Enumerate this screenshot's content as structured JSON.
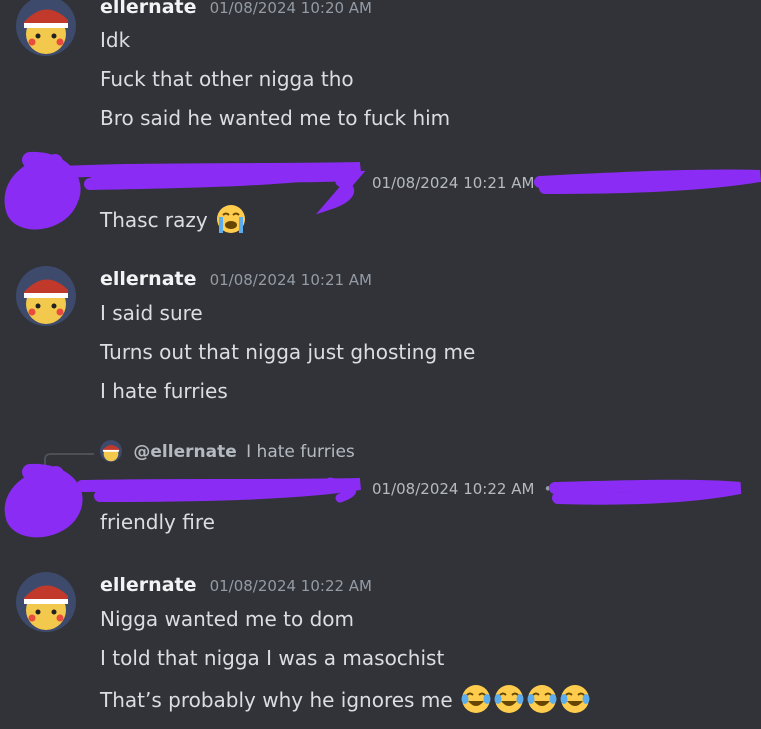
{
  "messages": [
    {
      "username": "ellernate",
      "timestamp": "01/08/2024 10:20 AM",
      "lines": [
        "Idk",
        "Fuck that other nigga tho",
        "Bro said he wanted me to fuck him"
      ]
    },
    {
      "username": "",
      "timestamp": "01/08/2024 10:21 AM",
      "lines": [
        "Thasc razy"
      ],
      "redacted": true,
      "emoji": [
        "loudly-crying-face"
      ]
    },
    {
      "username": "ellernate",
      "timestamp": "01/08/2024 10:21 AM",
      "lines": [
        "I said sure",
        "Turns out that nigga just ghosting me",
        "I hate furries"
      ]
    },
    {
      "username": "",
      "timestamp": "01/08/2024 10:22 AM",
      "timestamp_suffix": "•",
      "redacted": true,
      "reply": {
        "user": "@ellernate",
        "text": "I hate furries"
      },
      "lines": [
        "friendly fire"
      ]
    },
    {
      "username": "ellernate",
      "timestamp": "01/08/2024 10:22 AM",
      "lines": [
        "Nigga wanted me to dom",
        "I told that nigga I was a masochist",
        "That’s probably why he ignores me"
      ],
      "emoji": [
        "face-with-tears-of-joy",
        "face-with-tears-of-joy",
        "face-with-tears-of-joy",
        "face-with-tears-of-joy"
      ]
    }
  ],
  "colors": {
    "background": "#313338",
    "redaction": "#8b2cf5",
    "username": "#f2f3f5",
    "timestamp": "#949ba4",
    "text": "#dbdee1"
  }
}
